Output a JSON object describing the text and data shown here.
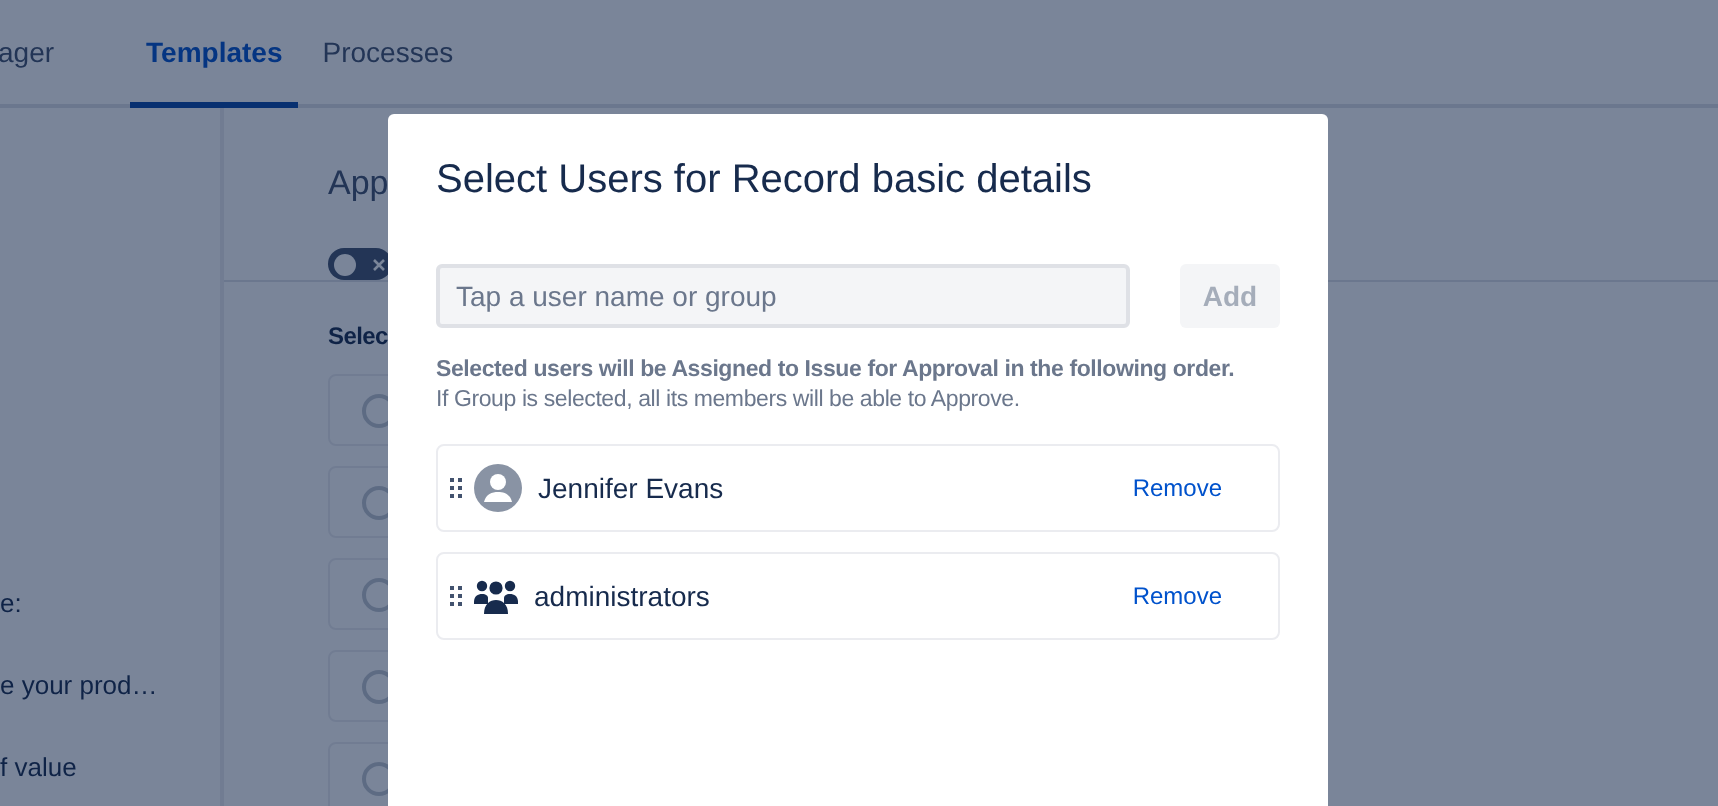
{
  "header": {
    "tabs": [
      {
        "label": "ager",
        "selected": false
      },
      {
        "label": "Templates",
        "selected": true
      },
      {
        "label": "Processes",
        "selected": false
      }
    ]
  },
  "sidebar": {
    "texts": [
      "e:",
      "e your prod…",
      "f value"
    ]
  },
  "panel": {
    "heading": "App",
    "toggle": {
      "on": false
    },
    "section_title": "Selec",
    "options": [
      {
        "selected": false
      },
      {
        "selected": false
      },
      {
        "selected": false
      },
      {
        "selected": false
      },
      {
        "selected": false
      }
    ]
  },
  "dialog": {
    "title": "Select Users for Record basic details",
    "search": {
      "placeholder": "Tap a user name or group"
    },
    "add_button": {
      "label": "Add",
      "disabled": true
    },
    "help": [
      "Selected users will be Assigned to Issue for Approval in the following order.",
      "If Group is selected, all its members will be able to Approve."
    ],
    "entries": [
      {
        "kind": "user",
        "name": "Jennifer Evans",
        "action": "Remove"
      },
      {
        "kind": "group",
        "name": "administrators",
        "action": "Remove"
      }
    ]
  }
}
